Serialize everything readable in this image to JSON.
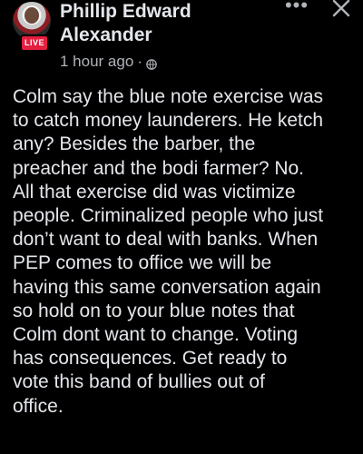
{
  "post": {
    "author_name": "Phillip Edward Alexander",
    "live_badge": "LIVE",
    "timestamp": "1 hour ago",
    "separator": "·",
    "privacy_icon": "globe-icon",
    "more_label": "•••",
    "close_icon": "close-icon",
    "text": "Colm say the blue note exercise was\nto catch money launderers. He ketch\nany? Besides the barber, the\npreacher and the bodi farmer? No.\nAll that exercise did was victimize\npeople. Criminalized people who just\ndon’t want to deal with banks. When\nPEP comes to office we will be\nhaving this same conversation again\nso hold on to your blue notes that\nColm dont want to change. Voting\nhas consequences. Get ready to\nvote this band of bullies out of\noffice."
  },
  "colors": {
    "background": "#000000",
    "primary_text": "#e4e6eb",
    "secondary_text": "#b0b3b8",
    "live_red": "#e41e3f"
  }
}
